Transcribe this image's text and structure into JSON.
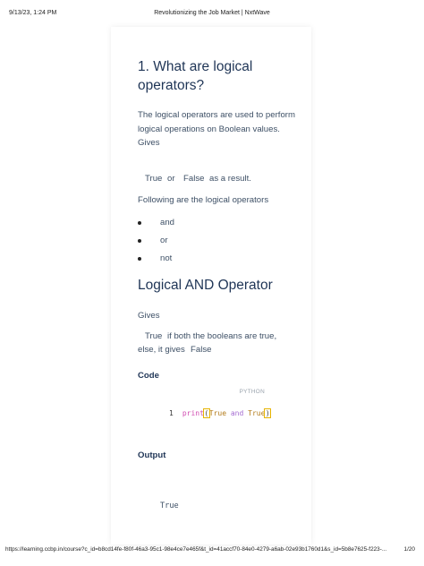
{
  "print_header": {
    "datetime": "9/13/23, 1:24 PM",
    "title": "Revolutionizing the Job Market | NxtWave"
  },
  "lesson": {
    "heading1": "1. What are logical operators?",
    "intro": "The logical operators are used to perform logical operations on Boolean values.",
    "gives_label": "Gives",
    "gives_true": "True",
    "gives_or": "or",
    "gives_false": "False",
    "gives_suffix": "as a result.",
    "following": "Following are the logical operators",
    "operators": [
      "and",
      "or",
      "not"
    ],
    "heading2": "Logical AND Operator",
    "and_gives_label": "Gives",
    "and_true": "True",
    "and_text1": "if both the booleans are true,",
    "and_text2": "else, it gives",
    "and_false": "False",
    "code_label": "Code",
    "code_lang": "PYTHON",
    "code_line_no": "1",
    "code_fn": "print",
    "code_open": "(",
    "code_arg1": "True",
    "code_op": "and",
    "code_arg2": "True",
    "code_close": ")",
    "output_label": "Output",
    "output_value": "True"
  },
  "print_footer": {
    "url": "https://learning.ccbp.in/course?c_id=b8cd14fe-f80f-46a3-95c1-98e4ce7e465f&t_id=41accf70-84e0-4279-a6ab-02e93b1760d1&s_id=5b8e7625-f223-...",
    "page": "1/20"
  }
}
